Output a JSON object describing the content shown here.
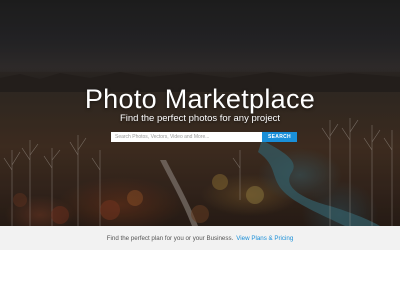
{
  "hero": {
    "title": "Photo Marketplace",
    "subtitle": "Find the perfect photos for any project"
  },
  "search": {
    "placeholder": "Search Photos, Vectors, Video and More...",
    "button_label": "SEARCH"
  },
  "promo": {
    "text": "Find the perfect plan for you or your Business.",
    "link_label": "View Plans & Pricing"
  },
  "colors": {
    "accent": "#1a8fd8",
    "promo_background": "#f2f2f2",
    "page_background": "#ffffff"
  }
}
